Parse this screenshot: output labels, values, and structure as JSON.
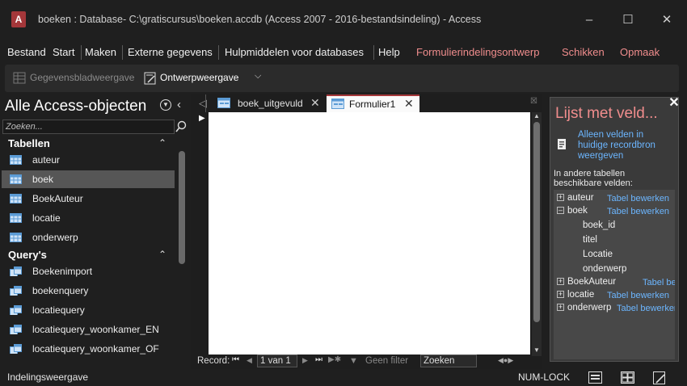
{
  "window": {
    "title": "boeken : Database- C:\\gratiscursus\\boeken.accdb (Access 2007 - 2016-bestandsindeling) - Access",
    "app_icon_letter": "A"
  },
  "menu": {
    "items": [
      "Bestand",
      "Start",
      "Maken",
      "Externe gegevens",
      "Hulpmiddelen voor databases",
      "Help"
    ],
    "context_items": [
      "Formulierindelingsontwerp",
      "Schikken",
      "Opmaak"
    ]
  },
  "ribbon": {
    "datasheet_view": "Gegevensbladweergave",
    "design_view": "Ontwerpweergave"
  },
  "nav": {
    "title": "Alle Access-objecten",
    "search_placeholder": "Zoeken...",
    "groups": [
      {
        "label": "Tabellen",
        "items": [
          "auteur",
          "boek",
          "BoekAuteur",
          "locatie",
          "onderwerp"
        ],
        "selected": "boek"
      },
      {
        "label": "Query's",
        "items": [
          "Boekenimport",
          "boekenquery",
          "locatiequery",
          "locatiequery_woonkamer_EN",
          "locatiequery_woonkamer_OF"
        ]
      }
    ]
  },
  "tabs": [
    {
      "label": "boek_uitgevuld",
      "active": false
    },
    {
      "label": "Formulier1",
      "active": true
    }
  ],
  "record_bar": {
    "label": "Record:",
    "position": "1 van 1",
    "filter": "Geen filter",
    "search": "Zoeken"
  },
  "field_list": {
    "title": "Lijst met veld...",
    "show_current_link": "Alleen velden in huidige recordbron weergeven",
    "other_tables_label": "In andere tabellen beschikbare velden:",
    "edit_label": "Tabel bewerken",
    "tables": [
      {
        "name": "auteur",
        "expanded": false
      },
      {
        "name": "boek",
        "expanded": true,
        "fields": [
          "boek_id",
          "titel",
          "Locatie",
          "onderwerp"
        ]
      },
      {
        "name": "BoekAuteur",
        "expanded": false
      },
      {
        "name": "locatie",
        "expanded": false
      },
      {
        "name": "onderwerp",
        "expanded": false
      }
    ]
  },
  "status": {
    "left": "Indelingsweergave",
    "numlock": "NUM-LOCK"
  },
  "colors": {
    "accent": "#a4373a",
    "context_tab": "#f08d8d",
    "link": "#6cb6ff",
    "selected_item": "#565656"
  }
}
